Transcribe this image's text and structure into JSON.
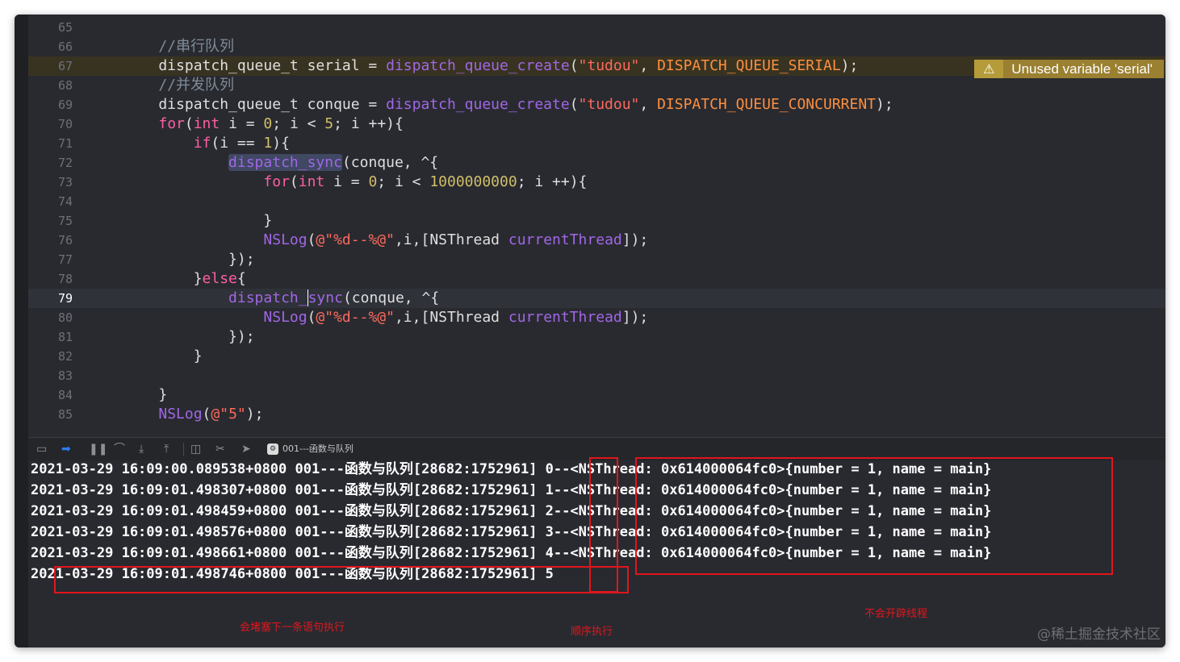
{
  "editor": {
    "lines": [
      {
        "num": "65",
        "segs": []
      },
      {
        "num": "66",
        "segs": [
          [
            "cmt",
            "    //串行队列"
          ]
        ]
      },
      {
        "num": "67",
        "segs": [
          [
            "",
            "    dispatch_queue_t serial = "
          ],
          [
            "fn",
            "dispatch_queue_create"
          ],
          [
            "",
            "("
          ],
          [
            "str",
            "\"tudou\""
          ],
          [
            "",
            ", "
          ],
          [
            "mac",
            "DISPATCH_QUEUE_SERIAL"
          ],
          [
            "",
            ");"
          ]
        ]
      },
      {
        "num": "68",
        "segs": [
          [
            "cmt",
            "    //并发队列"
          ]
        ]
      },
      {
        "num": "69",
        "segs": [
          [
            "",
            "    dispatch_queue_t conque = "
          ],
          [
            "fn",
            "dispatch_queue_create"
          ],
          [
            "",
            "("
          ],
          [
            "str",
            "\"tudou\""
          ],
          [
            "",
            ", "
          ],
          [
            "mac",
            "DISPATCH_QUEUE_CONCURRENT"
          ],
          [
            "",
            ");"
          ]
        ]
      },
      {
        "num": "70",
        "segs": [
          [
            "",
            "    "
          ],
          [
            "kw",
            "for"
          ],
          [
            "",
            "("
          ],
          [
            "kw",
            "int"
          ],
          [
            "",
            " i = "
          ],
          [
            "num",
            "0"
          ],
          [
            "",
            "; i < "
          ],
          [
            "num",
            "5"
          ],
          [
            "",
            "; i ++){"
          ]
        ]
      },
      {
        "num": "71",
        "segs": [
          [
            "",
            "        "
          ],
          [
            "kw",
            "if"
          ],
          [
            "",
            "(i == "
          ],
          [
            "num",
            "1"
          ],
          [
            "",
            "){"
          ]
        ]
      },
      {
        "num": "72",
        "segs": [
          [
            "",
            "            "
          ],
          [
            "fn hl",
            "dispatch_sync"
          ],
          [
            "",
            "(conque, ^{"
          ]
        ]
      },
      {
        "num": "73",
        "segs": [
          [
            "",
            "                "
          ],
          [
            "kw",
            "for"
          ],
          [
            "",
            "("
          ],
          [
            "kw",
            "int"
          ],
          [
            "",
            " i = "
          ],
          [
            "num",
            "0"
          ],
          [
            "",
            "; i < "
          ],
          [
            "num",
            "1000000000"
          ],
          [
            "",
            "; i ++){"
          ]
        ]
      },
      {
        "num": "74",
        "segs": []
      },
      {
        "num": "75",
        "segs": [
          [
            "",
            "                }"
          ]
        ]
      },
      {
        "num": "76",
        "segs": [
          [
            "",
            "                "
          ],
          [
            "fn",
            "NSLog"
          ],
          [
            "",
            "("
          ],
          [
            "str",
            "@\"%d--%@\""
          ],
          [
            "",
            ",i,[NSThread "
          ],
          [
            "fn",
            "currentThread"
          ],
          [
            "",
            "]);"
          ]
        ]
      },
      {
        "num": "77",
        "segs": [
          [
            "",
            "            });"
          ]
        ]
      },
      {
        "num": "78",
        "segs": [
          [
            "",
            "        }"
          ],
          [
            "kw",
            "else"
          ],
          [
            "",
            "{"
          ]
        ]
      },
      {
        "num": "79",
        "segs": [
          [
            "",
            "            "
          ],
          [
            "fn",
            "dispatch_"
          ],
          [
            "fn caret",
            "sync"
          ],
          [
            "",
            "(conque, ^{"
          ]
        ]
      },
      {
        "num": "80",
        "segs": [
          [
            "",
            "                "
          ],
          [
            "fn",
            "NSLog"
          ],
          [
            "",
            "("
          ],
          [
            "str",
            "@\"%d--%@\""
          ],
          [
            "",
            ",i,[NSThread "
          ],
          [
            "fn",
            "currentThread"
          ],
          [
            "",
            "]);"
          ]
        ]
      },
      {
        "num": "81",
        "segs": [
          [
            "",
            "            });"
          ]
        ]
      },
      {
        "num": "82",
        "segs": [
          [
            "",
            "        }"
          ]
        ]
      },
      {
        "num": "83",
        "segs": []
      },
      {
        "num": "84",
        "segs": [
          [
            "",
            "    }"
          ]
        ]
      },
      {
        "num": "85",
        "segs": [
          [
            "",
            "    "
          ],
          [
            "fn",
            "NSLog"
          ],
          [
            "",
            "("
          ],
          [
            "str",
            "@\"5\""
          ],
          [
            "",
            ");"
          ]
        ]
      }
    ],
    "warning_line": "67",
    "current_line": "79",
    "warning": {
      "icon": "warning-triangle-icon",
      "text": "Unused variable 'serial'"
    }
  },
  "debug_bar": {
    "target_label": "001---函数与队列",
    "icons": [
      "hide-debug-area-icon",
      "breakpoints-toggle-icon",
      "pause-icon",
      "step-over-icon",
      "step-into-icon",
      "step-out-icon",
      "view-hierarchy-icon",
      "memory-graph-icon",
      "simulate-location-icon"
    ]
  },
  "console": {
    "lines": [
      "2021-03-29 16:09:00.089538+0800 001---函数与队列[28682:1752961] 0--<NSThread: 0x614000064fc0>{number = 1, name = main}",
      "2021-03-29 16:09:01.498307+0800 001---函数与队列[28682:1752961] 1--<NSThread: 0x614000064fc0>{number = 1, name = main}",
      "2021-03-29 16:09:01.498459+0800 001---函数与队列[28682:1752961] 2--<NSThread: 0x614000064fc0>{number = 1, name = main}",
      "2021-03-29 16:09:01.498576+0800 001---函数与队列[28682:1752961] 3--<NSThread: 0x614000064fc0>{number = 1, name = main}",
      "2021-03-29 16:09:01.498661+0800 001---函数与队列[28682:1752961] 4--<NSThread: 0x614000064fc0>{number = 1, name = main}",
      "2021-03-29 16:09:01.498746+0800 001---函数与队列[28682:1752961] 5"
    ]
  },
  "annotations": {
    "block_note": "会堵塞下一条语句执行",
    "order_note": "顺序执行",
    "thread_note": "不会开辟线程"
  },
  "watermark": "@稀土掘金技术社区",
  "colors": {
    "keyword": "#fc5fa3",
    "function": "#a167e6",
    "string": "#fc6a5d",
    "number": "#d0bf69",
    "macro": "#fd8f3f",
    "comment": "#7f8c98",
    "annotation": "#e0161c"
  }
}
